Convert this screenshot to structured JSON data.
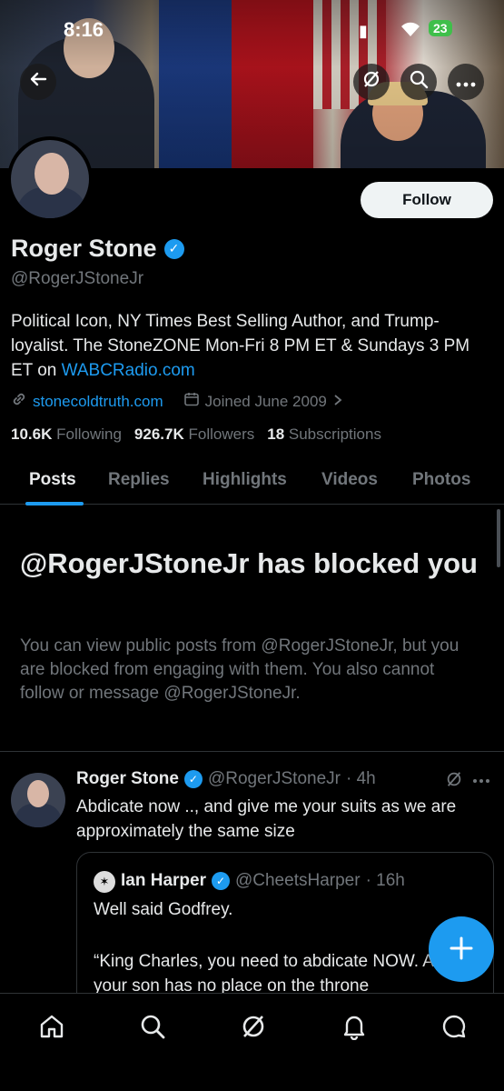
{
  "status_bar": {
    "time": "8:16",
    "battery": "23"
  },
  "profile": {
    "name": "Roger Stone",
    "handle": "@RogerJStoneJr",
    "bio_prefix": "Political Icon, NY Times Best Selling Author, and Trump-loyalist. The StoneZONE Mon-Fri 8 PM ET & Sundays 3 PM ET on ",
    "bio_link": "WABCRadio.com",
    "website": "stonecoldtruth.com",
    "joined": "Joined June 2009",
    "following_count": "10.6K",
    "following_label": "Following",
    "followers_count": "926.7K",
    "followers_label": "Followers",
    "subscriptions_count": "18",
    "subscriptions_label": "Subscriptions",
    "follow_button": "Follow"
  },
  "tabs": [
    {
      "label": "Posts",
      "active": true
    },
    {
      "label": "Replies",
      "active": false
    },
    {
      "label": "Highlights",
      "active": false
    },
    {
      "label": "Videos",
      "active": false
    },
    {
      "label": "Photos",
      "active": false
    }
  ],
  "blocked": {
    "title": "@RogerJStoneJr has blocked you",
    "text": "You can view public posts from @RogerJStoneJr, but you are blocked from engaging with them. You also cannot follow or message @RogerJStoneJr."
  },
  "tweet": {
    "author": "Roger Stone",
    "handle": "@RogerJStoneJr",
    "time": "· 4h",
    "text": "Abdicate now .., and give me your suits as we are approximately the same size",
    "quote": {
      "author": "Ian Harper",
      "handle": "@CheetsHarper",
      "time": "· 16h",
      "line1": "Well said Godfrey.",
      "line2": "“King Charles, you need to abdicate NOW. And your son has no place on the throne"
    }
  },
  "colors": {
    "accent": "#1d9bf0",
    "background": "#000000",
    "secondary_text": "#71767b"
  },
  "icons": [
    "back-arrow-icon",
    "grok-icon",
    "search-icon",
    "more-icon",
    "link-icon",
    "calendar-icon",
    "chevron-right-icon",
    "verified-badge-icon",
    "plus-icon",
    "home-icon",
    "notifications-icon",
    "messages-icon"
  ]
}
